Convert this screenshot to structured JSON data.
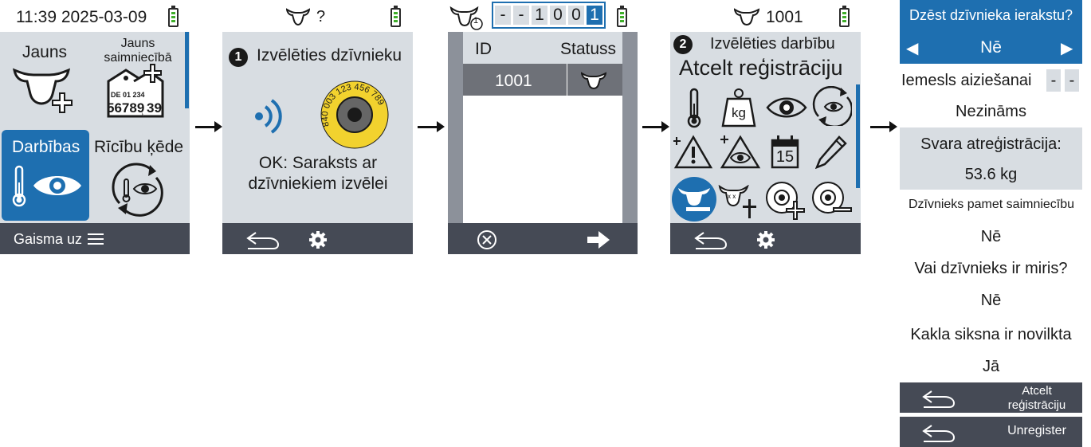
{
  "screen1": {
    "time": "11:39 2025-03-09",
    "tile_new": "Jauns",
    "tile_new_farm": "Jauns saimniecībā",
    "tag_line1": "DE 01 234",
    "tag_line2": "56789",
    "tag_back": "39",
    "tile_actions": "Darbības",
    "tile_chain": "Rīcību ķēde",
    "bottom_label": "Gaisma uz",
    "icons": [
      "cow-add-icon",
      "ear-tag-add-icon",
      "thermometer-icon",
      "eye-icon",
      "rotate-thermometer-eye-icon",
      "menu-icon"
    ]
  },
  "screen2": {
    "status_text": "?",
    "step": "1",
    "heading": "Izvēlēties dzīvnieku",
    "tag_number": "840 003 123 456 789",
    "ok_text": "OK: Saraksts ar dzīvniekiem izvēlei",
    "icons": [
      "cow-icon",
      "rfid-signal-icon",
      "ear-tag-icon",
      "back-icon",
      "gear-icon"
    ]
  },
  "screen3": {
    "counter_badge": "1",
    "digits": [
      "-",
      "-",
      "1",
      "0",
      "0",
      "1"
    ],
    "col_id": "ID",
    "col_status": "Statuss",
    "row_id": "1001",
    "icons": [
      "cow-filter-icon",
      "cow-status-icon",
      "cancel-icon",
      "arrow-right-icon"
    ]
  },
  "screen4": {
    "animal_id": "1001",
    "step": "2",
    "heading": "Izvēlēties darbību",
    "action_title": "Atcelt reģistrāciju",
    "kg": "kg",
    "calendar_day": "15",
    "icons": [
      "thermometer-icon",
      "weight-icon",
      "eye-icon",
      "rotate-eye-icon",
      "warning-icon",
      "warning-eye-icon",
      "calendar-icon",
      "pencil-icon",
      "cow-unregister-icon",
      "cow-dead-icon",
      "ear-tag-add-icon",
      "ear-tag-remove-icon",
      "back-icon",
      "gear-icon"
    ]
  },
  "form": {
    "question": "Dzēst dzīvnieka ierakstu?",
    "answer": "Nē",
    "reason_label": "Iemesls aiziešanai",
    "reason_digits": [
      "-",
      "-"
    ],
    "reason_value": "Nezināms",
    "weight_label": "Svara atreģistrācija:",
    "weight_value": "53.6 kg",
    "leaves_label": "Dzīvnieks pamet saimniecību",
    "leaves_value": "Nē",
    "dead_label": "Vai dzīvnieks ir miris?",
    "dead_value": "Nē",
    "collar_label": "Kakla siksna ir novilkta",
    "collar_value": "Jā",
    "button1": "Atcelt reģistrāciju",
    "button2": "Unregister"
  },
  "colors": {
    "accent": "#1e6fb0",
    "screen_bg": "#d8dde2",
    "bar": "#454a55",
    "battery": "#3fae2a",
    "tag_yellow": "#f2d22e"
  }
}
